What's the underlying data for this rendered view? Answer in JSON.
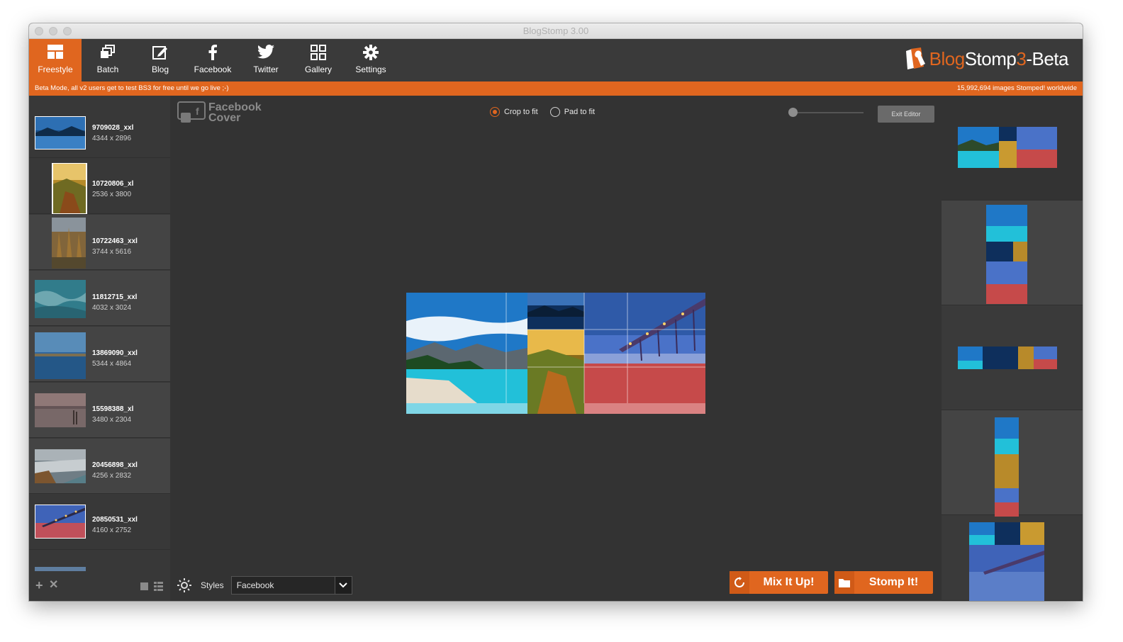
{
  "window": {
    "title": "BlogStomp 3.00"
  },
  "toolbar": {
    "tabs": [
      {
        "label": "Freestyle",
        "icon": "freestyle-icon"
      },
      {
        "label": "Batch",
        "icon": "batch-icon"
      },
      {
        "label": "Blog",
        "icon": "blog-edit-icon"
      },
      {
        "label": "Facebook",
        "icon": "facebook-icon"
      },
      {
        "label": "Twitter",
        "icon": "twitter-icon"
      },
      {
        "label": "Gallery",
        "icon": "gallery-grid-icon"
      },
      {
        "label": "Settings",
        "icon": "gear-icon"
      }
    ],
    "active_tab": "Freestyle",
    "logo": {
      "part1": "Blog",
      "part2": "Stomp",
      "part3": "3",
      "part4": "-Beta"
    }
  },
  "banner": {
    "left": "Beta Mode, all v2 users get to test BS3 for free until we go live ;-)",
    "right": "15,992,694 images Stomped! worldwide"
  },
  "images": [
    {
      "name": "9709028_xxl",
      "size": "4344 x 2896"
    },
    {
      "name": "10720806_xl",
      "size": "2536 x 3800"
    },
    {
      "name": "10722463_xxl",
      "size": "3744 x 5616"
    },
    {
      "name": "11812715_xxl",
      "size": "4032 x 3024"
    },
    {
      "name": "13869090_xxl",
      "size": "5344 x 4864"
    },
    {
      "name": "15598388_xl",
      "size": "3480 x 2304"
    },
    {
      "name": "20456898_xxl",
      "size": "4256 x 2832"
    },
    {
      "name": "20850531_xxl",
      "size": "4160 x 2752"
    }
  ],
  "editor": {
    "format_label_line1": "Facebook",
    "format_label_line2": "Cover",
    "crop_label": "Crop to fit",
    "pad_label": "Pad to fit",
    "selected_fit": "Crop to fit",
    "exit_label": "Exit Editor"
  },
  "styles": {
    "label": "Styles",
    "value": "Facebook"
  },
  "buttons": {
    "mix": "Mix It Up!",
    "stomp": "Stomp It!"
  },
  "colors": {
    "accent": "#e0661f",
    "toolbar": "#3a3a3a",
    "panel": "#383838",
    "canvas": "#333333"
  }
}
